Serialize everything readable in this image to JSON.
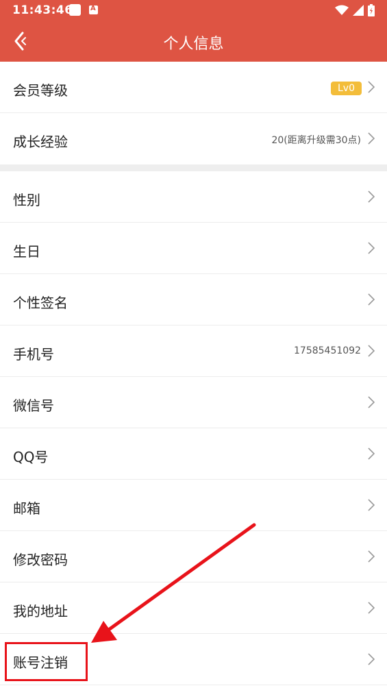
{
  "status_bar": {
    "time": "11:43:46",
    "icons": [
      "app-notification-icon",
      "app-a-icon",
      "wifi-icon",
      "signal-icon",
      "battery-icon"
    ]
  },
  "nav": {
    "title": "个人信息",
    "back_icon": "back-chevron-icon"
  },
  "rows": {
    "member_level": {
      "label": "会员等级",
      "badge": "Lv0"
    },
    "growth_exp": {
      "label": "成长经验",
      "value": "20(距离升级需30点)"
    },
    "gender": {
      "label": "性别"
    },
    "birthday": {
      "label": "生日"
    },
    "signature": {
      "label": "个性签名"
    },
    "phone": {
      "label": "手机号",
      "value": "17585451092"
    },
    "wechat": {
      "label": "微信号"
    },
    "qq": {
      "label": "QQ号"
    },
    "email": {
      "label": "邮箱"
    },
    "change_password": {
      "label": "修改密码"
    },
    "address": {
      "label": "我的地址"
    },
    "cancel_account": {
      "label": "账号注销"
    }
  },
  "colors": {
    "brand": "#de5443",
    "badge": "#f3bd3a",
    "annotation": "#e8131a"
  }
}
